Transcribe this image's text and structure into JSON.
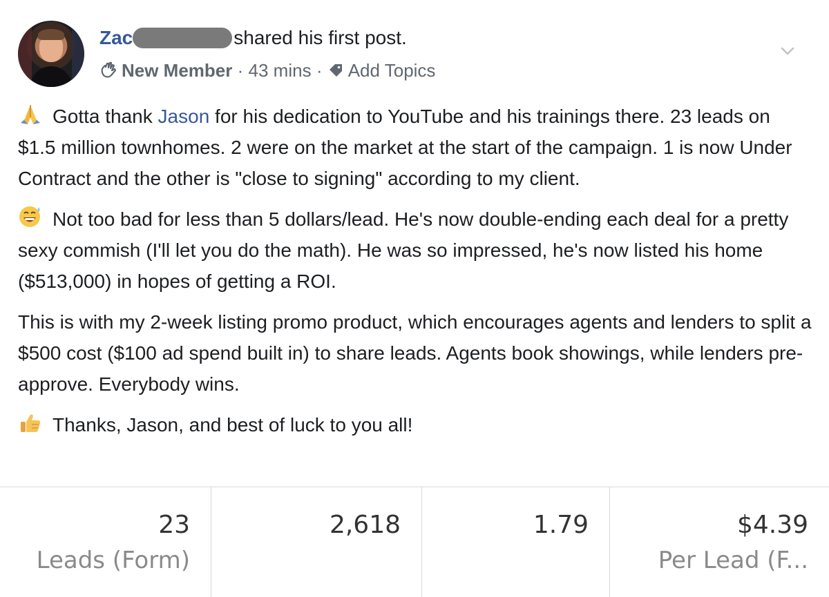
{
  "post": {
    "author_name": "Zac",
    "author_action": "shared his first post.",
    "badge": "New Member",
    "separator": "·",
    "timestamp": "43 mins",
    "topics_label": "Add Topics",
    "paragraphs": [
      {
        "emoji": "folded-hands",
        "before": "Gotta thank ",
        "mention": "Jason",
        "after": " for his dedication to YouTube and his trainings there. 23 leads on $1.5 million townhomes. 2 were on the market at the start of the campaign. 1 is now Under Contract and the other is \"close to signing\" according to my client."
      },
      {
        "emoji": "grinning-sweat",
        "text": "Not too bad for less than 5 dollars/lead. He's now double-ending each deal for a pretty sexy commish (I'll let you do the math). He was so impressed, he's now listed his home ($513,000) in hopes of getting a ROI."
      },
      {
        "text": "This is with my 2-week listing promo product, which encourages agents and lenders to split a $500 cost ($100 ad spend built in) to share leads. Agents book showings, while lenders pre-approve. Everybody wins."
      },
      {
        "emoji": "thumbs-up",
        "text": "Thanks, Jason, and best of luck to you all!"
      }
    ]
  },
  "stats": [
    {
      "value": "23",
      "label": "Leads (Form)"
    },
    {
      "value": "2,618",
      "label": ""
    },
    {
      "value": "1.79",
      "label": ""
    },
    {
      "value": "$4.39",
      "label": "Per Lead (F..."
    }
  ],
  "colors": {
    "link": "#365899",
    "muted": "#606770",
    "text": "#1c1e21"
  }
}
